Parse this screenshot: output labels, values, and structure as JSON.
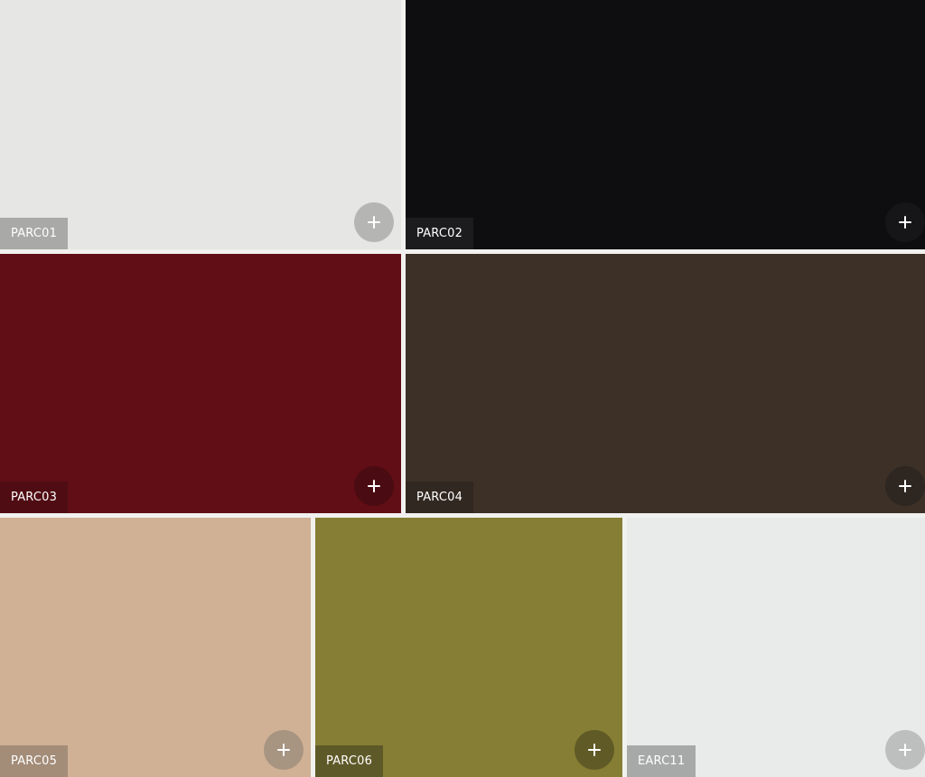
{
  "swatches": [
    {
      "code": "PARC01",
      "color": "#e6e7e4",
      "label_bg": "#a9a9a7",
      "button_bg": "#b5b6b3"
    },
    {
      "code": "PARC02",
      "color": "#0e0e10",
      "label_bg": "#1c1c1e",
      "button_bg": "#161618"
    },
    {
      "code": "PARC03",
      "color": "#610e16",
      "label_bg": "#4f0d13",
      "button_bg": "#4a0c12"
    },
    {
      "code": "PARC04",
      "color": "#3c3027",
      "label_bg": "#312821",
      "button_bg": "#2e2620"
    },
    {
      "code": "PARC05",
      "color": "#d0b196",
      "label_bg": "#a38c78",
      "button_bg": "#a79481"
    },
    {
      "code": "PARC06",
      "color": "#857e34",
      "label_bg": "#5e5928",
      "button_bg": "#5f5a26"
    },
    {
      "code": "EARC11",
      "color": "#e8ebea",
      "label_bg": "#a7a9a8",
      "button_bg": "#bcbfbe"
    }
  ],
  "add_icon": "plus-icon"
}
